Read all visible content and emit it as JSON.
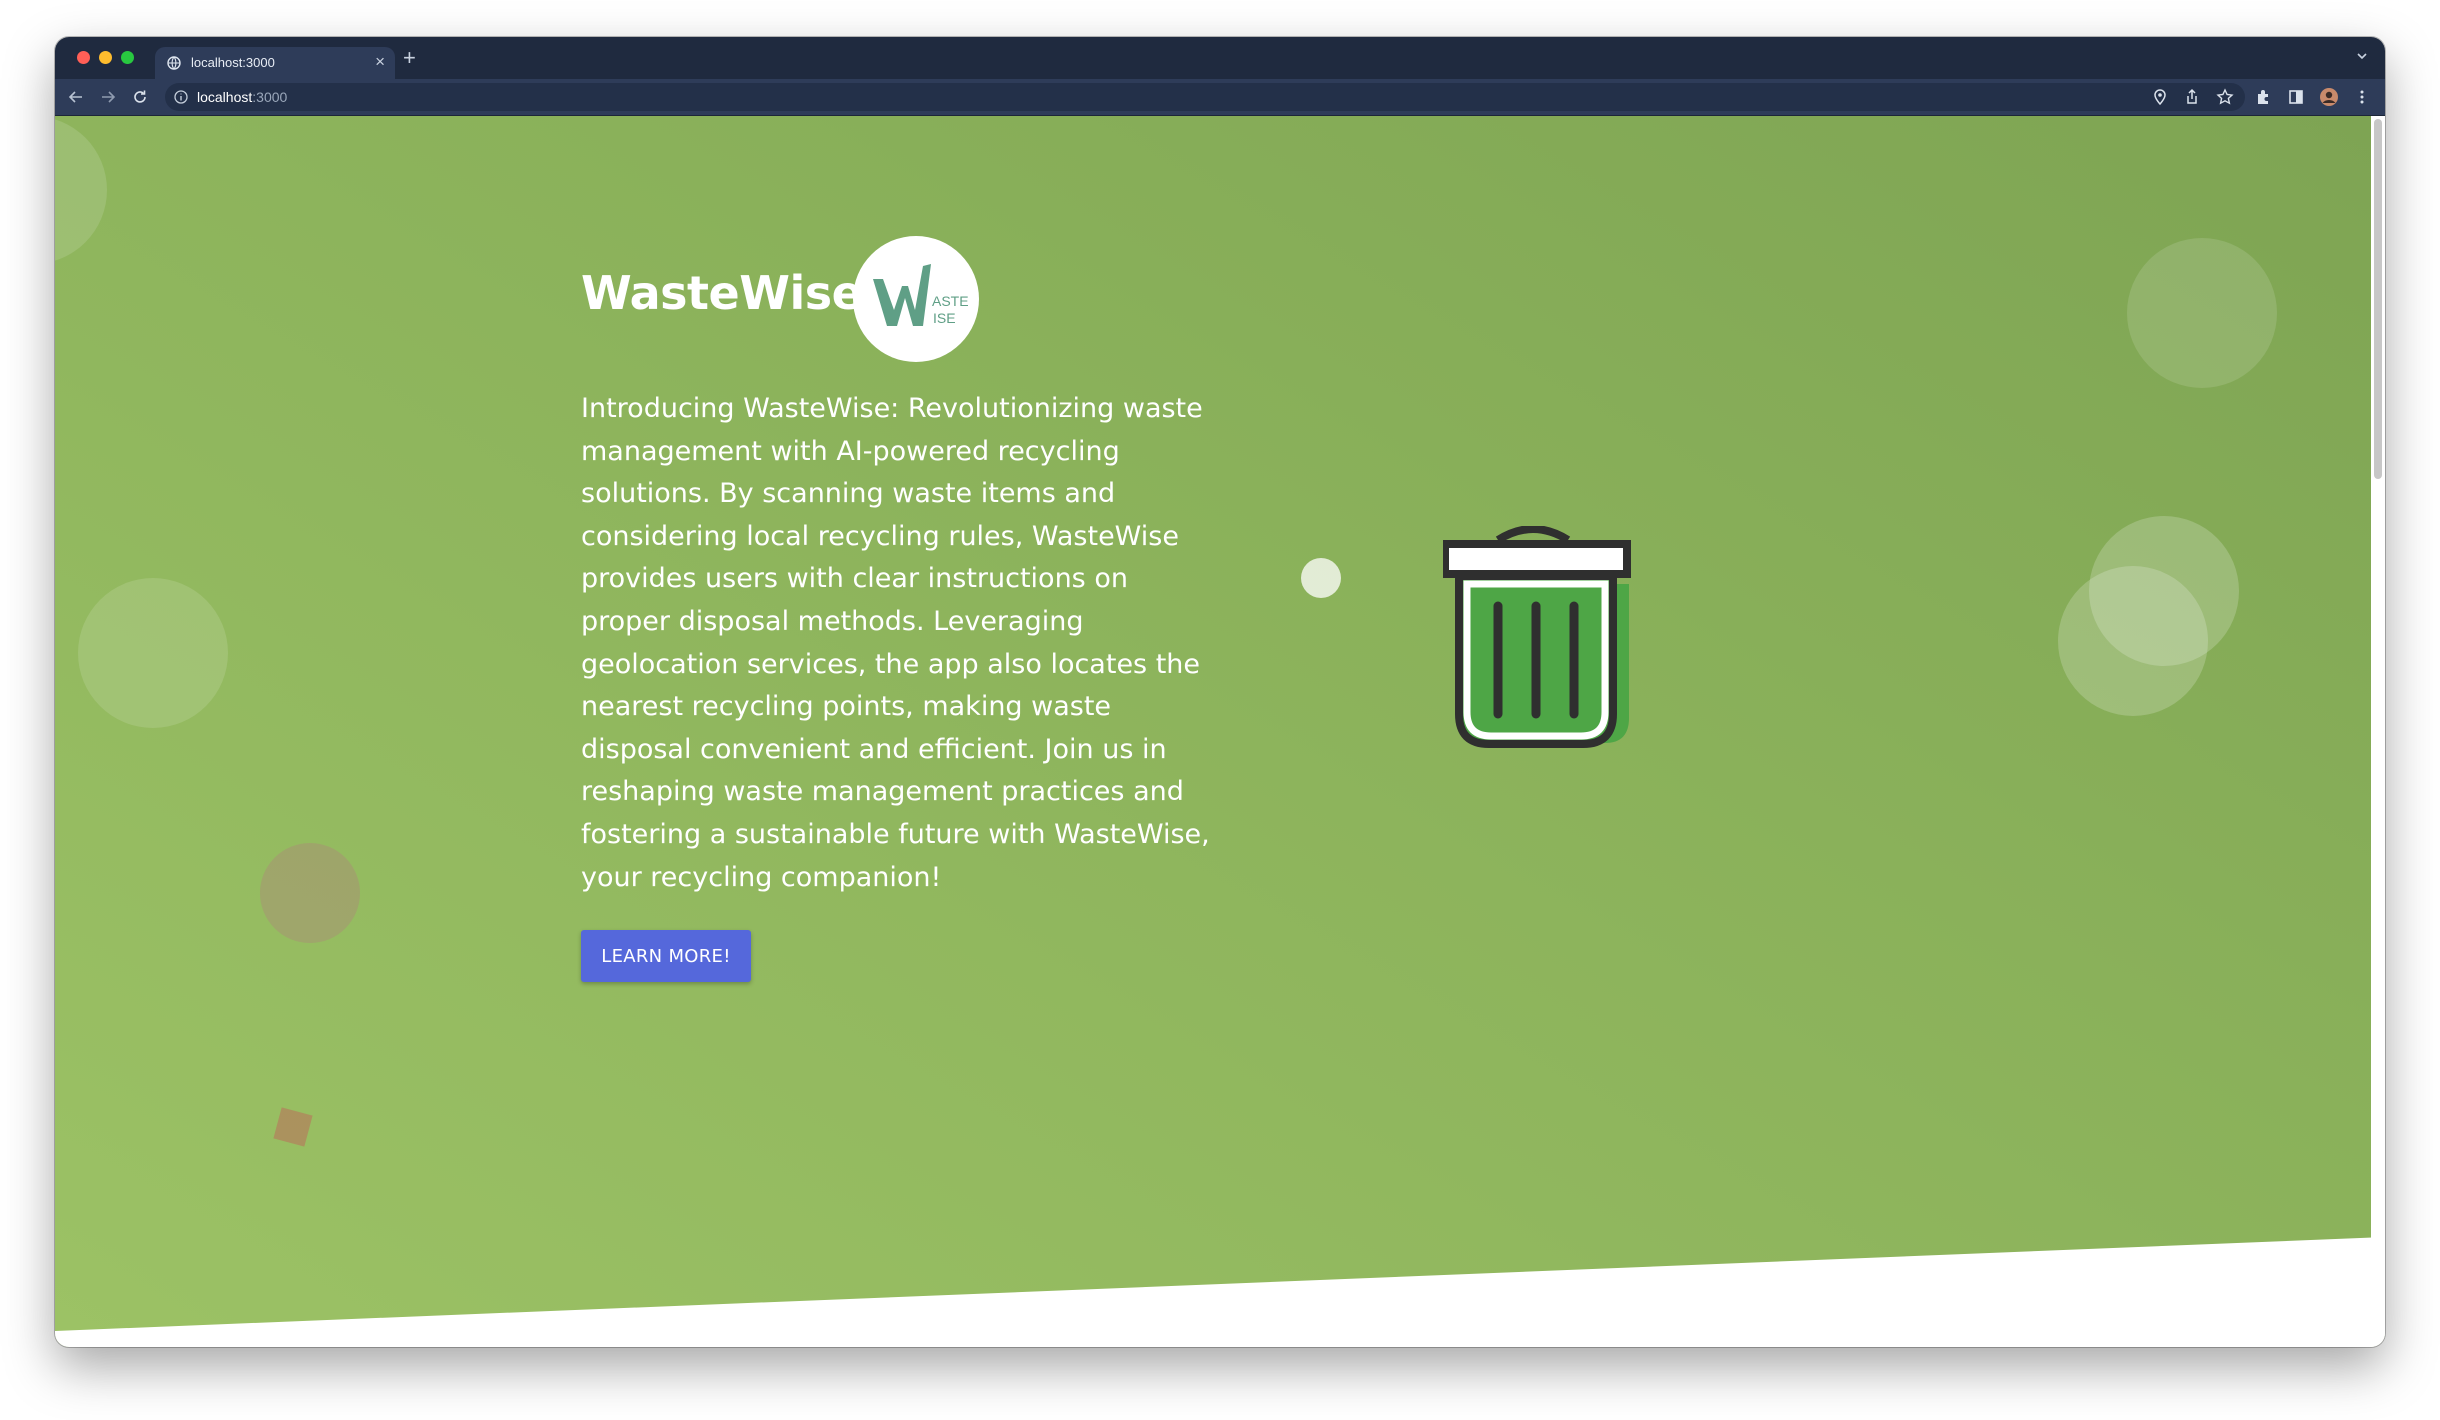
{
  "browser": {
    "tab_title": "localhost:3000",
    "new_tab_symbol": "+",
    "tab_close_symbol": "×",
    "url_host": "localhost",
    "url_port": ":3000",
    "icons": [
      "back-arrow-icon",
      "forward-arrow-icon",
      "reload-icon",
      "info-icon",
      "location-pin-icon",
      "share-icon",
      "star-icon",
      "extensions-puzzle-icon",
      "side-panel-icon",
      "profile-avatar-icon",
      "kebab-menu-icon"
    ]
  },
  "hero": {
    "title": "WasteWise",
    "logo_text_large": "W",
    "logo_text_top": "ASTE",
    "logo_text_bottom": "ISE",
    "description": "Introducing WasteWise: Revolutionizing waste management with AI-powered recycling solutions. By scanning waste items and considering local recycling rules, WasteWise provides users with clear instructions on proper disposal methods. Leveraging geolocation services, the app also locates the nearest recycling points, making waste disposal convenient and efficient. Join us in reshaping waste management practices and fostering a sustainable future with WasteWise, your recycling companion!",
    "cta_label": "LEARN MORE!",
    "illustration": "trash-bin-icon"
  },
  "colors": {
    "background_green": "#8ab15a",
    "cta_blue": "#5568db",
    "bin_green": "#4ea646",
    "logo_teal": "#5f9f86"
  }
}
